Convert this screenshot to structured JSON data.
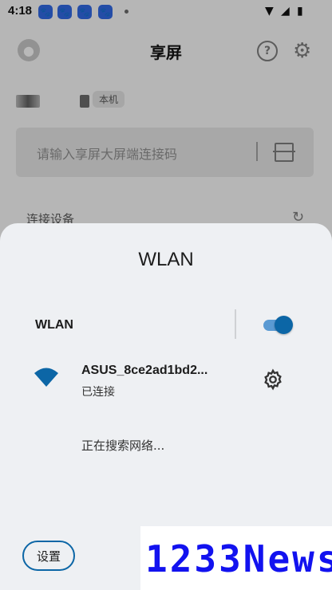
{
  "statusbar": {
    "time": "4:18"
  },
  "app": {
    "title": "享屏",
    "local_badge": "本机",
    "code_placeholder": "请输入享屏大屏端连接码",
    "section_label": "连接设备"
  },
  "dialog": {
    "title": "WLAN",
    "wlan_toggle_label": "WLAN",
    "wlan_enabled": true,
    "network": {
      "name": "ASUS_8ce2ad1bd2...",
      "status": "已连接"
    },
    "searching_text": "正在搜索网络...",
    "settings_button": "设置"
  },
  "watermark": "1233News",
  "colors": {
    "accent": "#0c66a6",
    "watermark": "#1212ef"
  }
}
